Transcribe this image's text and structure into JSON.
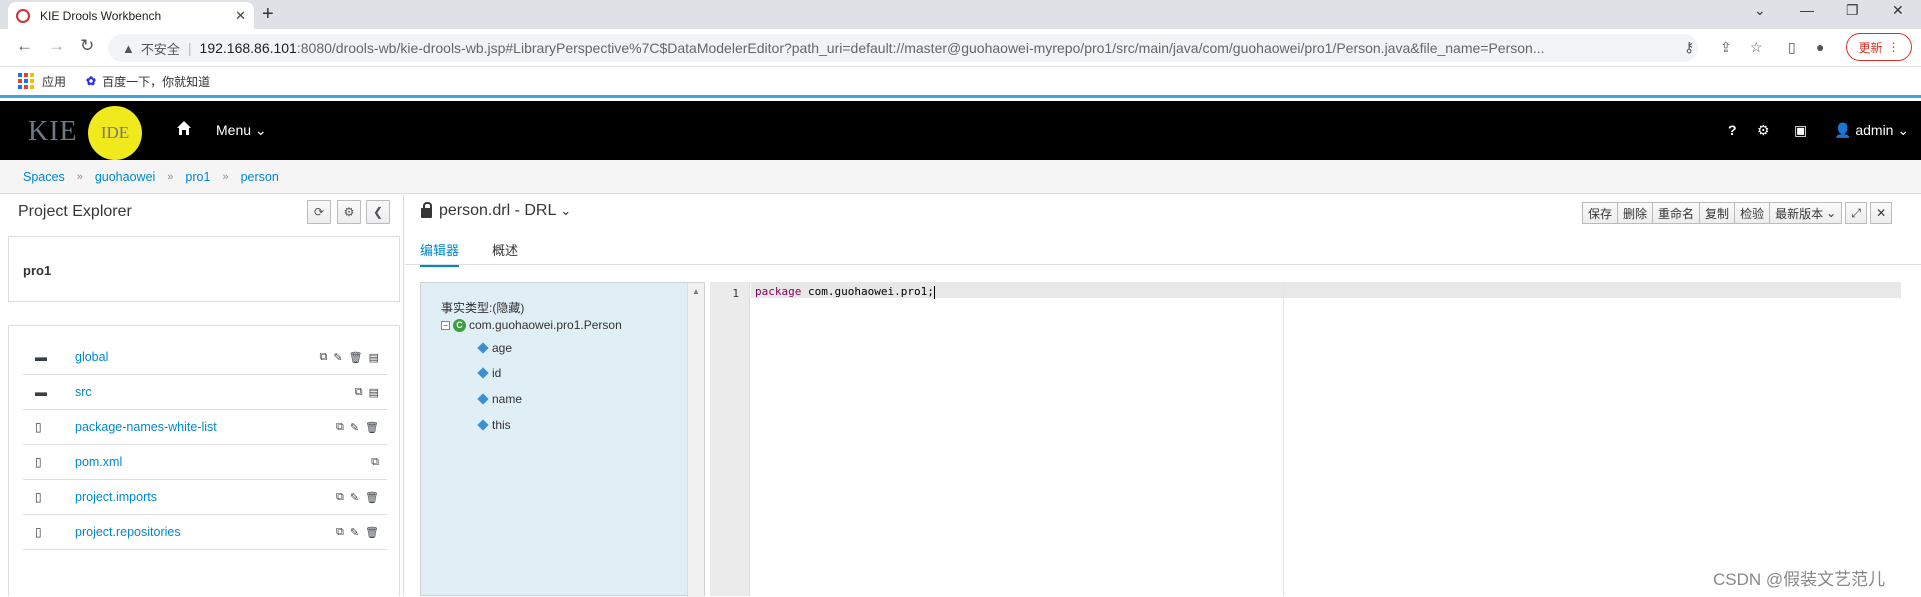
{
  "browser": {
    "tab_title": "KIE Drools Workbench",
    "close_glyph": "✕",
    "new_tab_glyph": "+",
    "insecure_label": "不安全",
    "url_host": "192.168.86.101",
    "url_path": ":8080/drools-wb/kie-drools-wb.jsp#LibraryPerspective%7C$DataModelerEditor?path_uri=default://master@guohaowei-myrepo/pro1/src/main/java/com/guohaowei/pro1/Person.java&file_name=Person...",
    "update_label": "更新",
    "bookmarks": [
      {
        "label": "应用"
      },
      {
        "label": "百度一下，你就知道"
      }
    ]
  },
  "header": {
    "logo_text": "KIE",
    "logo_badge": "IDE",
    "menu_label": "Menu",
    "help_label": "?",
    "user_label": "admin"
  },
  "breadcrumb": [
    "Spaces",
    "guohaowei",
    "pro1",
    "person"
  ],
  "explorer": {
    "title": "Project Explorer",
    "project_name": "pro1",
    "files": [
      {
        "name": "global",
        "type": "folder"
      },
      {
        "name": "src",
        "type": "folder"
      },
      {
        "name": "package-names-white-list",
        "type": "file"
      },
      {
        "name": "pom.xml",
        "type": "file"
      },
      {
        "name": "project.imports",
        "type": "file"
      },
      {
        "name": "project.repositories",
        "type": "file"
      }
    ]
  },
  "editor": {
    "title": "person.drl - DRL",
    "buttons": {
      "save": "保存",
      "delete": "删除",
      "rename": "重命名",
      "copy": "复制",
      "validate": "检验",
      "latest": "最新版本"
    },
    "tabs": {
      "editor": "编辑器",
      "overview": "概述"
    },
    "facts": {
      "header": "事实类型:(隐藏)",
      "class_name": "com.guohaowei.pro1.Person",
      "fields": [
        "age",
        "id",
        "name",
        "this"
      ]
    },
    "code": {
      "line_number": "1",
      "keyword": "package",
      "rest": " com.guohaowei.pro1;"
    }
  },
  "watermark": "CSDN @假装文艺范儿"
}
